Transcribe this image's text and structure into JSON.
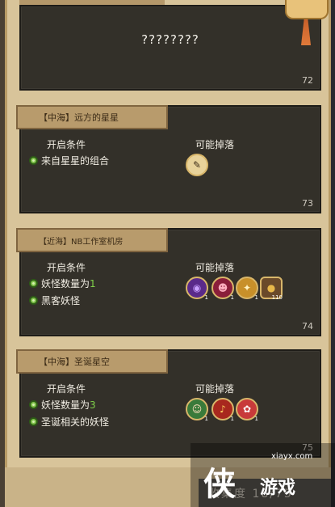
{
  "top_card": {
    "text": "????????",
    "number": "72"
  },
  "labels": {
    "condition": "开启条件",
    "drops": "可能掉落"
  },
  "cards": [
    {
      "title": "【中海】远方的星星",
      "conditions": [
        {
          "text": "来自星星的组合",
          "highlight": ""
        }
      ],
      "drops": [
        {
          "icon": "paper-icon",
          "symbol": "✎",
          "count": ""
        }
      ],
      "number": "73"
    },
    {
      "title": "【近海】NB工作室机房",
      "conditions": [
        {
          "text": "妖怪数量为",
          "highlight": "1"
        },
        {
          "text": "黑客妖怪",
          "highlight": ""
        }
      ],
      "drops": [
        {
          "icon": "vortex-icon",
          "symbol": "◉",
          "count": "1"
        },
        {
          "icon": "demon-face-icon",
          "symbol": "☻",
          "count": "1"
        },
        {
          "icon": "golden-figure-icon",
          "symbol": "✦",
          "count": "1"
        },
        {
          "icon": "coin-pot-icon",
          "symbol": "●",
          "count": "110"
        }
      ],
      "number": "74"
    },
    {
      "title": "【中海】圣诞星空",
      "conditions": [
        {
          "text": "妖怪数量为",
          "highlight": "3"
        },
        {
          "text": "圣诞相关的妖怪",
          "highlight": ""
        }
      ],
      "drops": [
        {
          "icon": "elf-icon",
          "symbol": "☺",
          "count": "1"
        },
        {
          "icon": "bell-icon",
          "symbol": "♪",
          "count": "1"
        },
        {
          "icon": "candy-cane-icon",
          "symbol": "✿",
          "count": "1"
        }
      ],
      "number": "75"
    }
  ],
  "footer": {
    "collection_label": "收集度 18/75"
  },
  "watermark": {
    "url": "xiayx.com",
    "big": "侠",
    "name": "游戏"
  },
  "colors": {
    "card": "#333029",
    "parchment": "#d8c49a",
    "tab": "#b89b6c",
    "condition_dot": "#7fc24a",
    "highlight": "#7fd04a"
  }
}
